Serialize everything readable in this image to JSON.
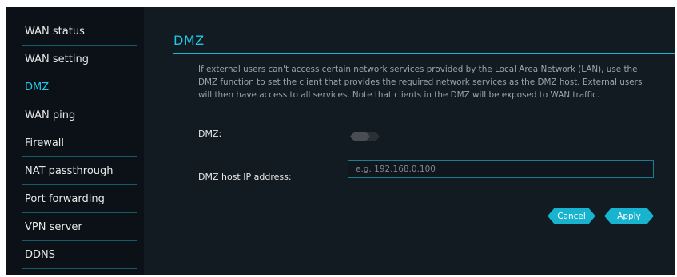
{
  "sidebar": {
    "items": [
      {
        "label": "WAN status",
        "active": false
      },
      {
        "label": "WAN setting",
        "active": false
      },
      {
        "label": "DMZ",
        "active": true
      },
      {
        "label": "WAN ping",
        "active": false
      },
      {
        "label": "Firewall",
        "active": false
      },
      {
        "label": "NAT passthrough",
        "active": false
      },
      {
        "label": "Port forwarding",
        "active": false
      },
      {
        "label": "VPN server",
        "active": false
      },
      {
        "label": "DDNS",
        "active": false
      }
    ]
  },
  "main": {
    "title": "DMZ",
    "description": "If external users can't access certain network services provided by the Local Area Network (LAN), use the DMZ function to set the client that provides the required network services as the DMZ host. External users will then have access to all services. Note that clients in the DMZ will be exposed to WAN traffic.",
    "dmz_label": "DMZ:",
    "dmz_enabled": false,
    "ip_label": "DMZ host IP address:",
    "ip_value": "",
    "ip_placeholder": "e.g. 192.168.0.100",
    "cancel_label": "Cancel",
    "apply_label": "Apply"
  },
  "colors": {
    "accent": "#1ec8e6",
    "background": "#121a22",
    "sidebar_bg": "#0b1116"
  }
}
